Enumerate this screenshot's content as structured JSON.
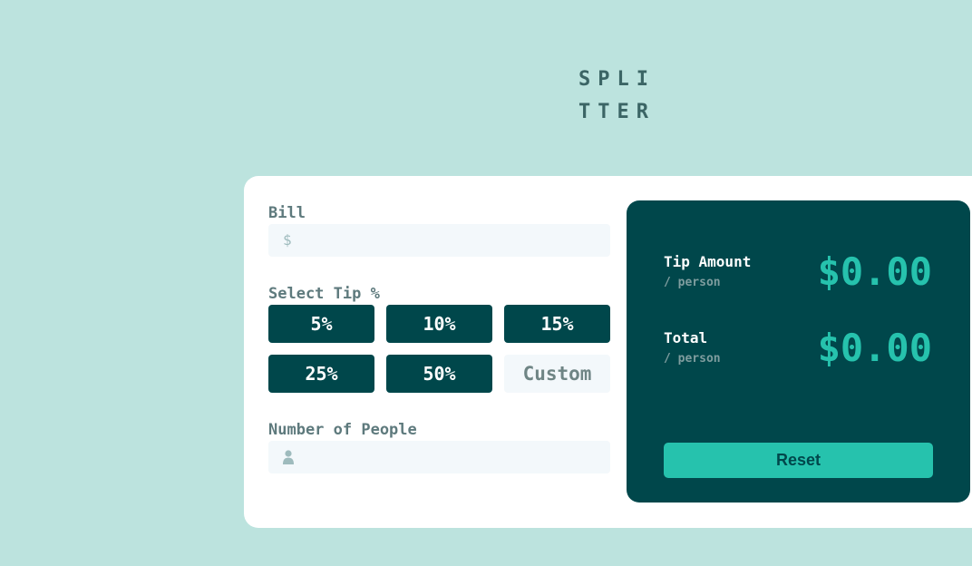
{
  "logo": {
    "line1": "SPLI",
    "line2": "TTER"
  },
  "bill": {
    "label": "Bill",
    "prefix": "$",
    "value": ""
  },
  "tip": {
    "label": "Select Tip %",
    "options": [
      "5%",
      "10%",
      "15%",
      "25%",
      "50%"
    ],
    "custom_placeholder": "Custom"
  },
  "people": {
    "label": "Number of People",
    "icon": "person-icon",
    "value": ""
  },
  "results": {
    "tip_amount": {
      "title": "Tip Amount",
      "sub": "/ person",
      "value": "$0.00"
    },
    "total": {
      "title": "Total",
      "sub": "/ person",
      "value": "$0.00"
    },
    "reset_label": "Reset"
  },
  "colors": {
    "background": "#bce3de",
    "dark": "#00474b",
    "accent": "#26c2ad",
    "input_bg": "#f3f8fb"
  }
}
